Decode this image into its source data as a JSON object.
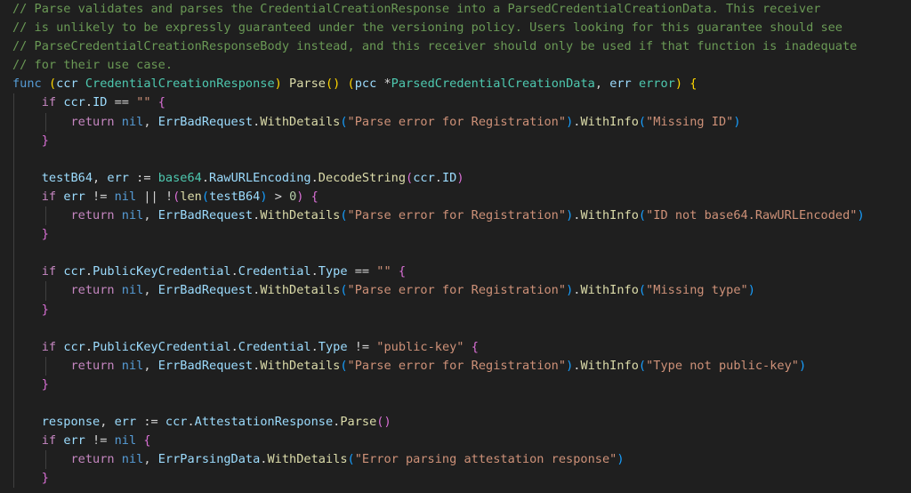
{
  "editor": {
    "language": "go",
    "lines": [
      {
        "indent": 0,
        "tokens": [
          [
            "// Parse validates and parses the CredentialCreationResponse into a ParsedCredentialCreationData. This receiver",
            "comment"
          ]
        ]
      },
      {
        "indent": 0,
        "tokens": [
          [
            "// is unlikely to be expressly guaranteed under the versioning policy. Users looking for this guarantee should see",
            "comment"
          ]
        ]
      },
      {
        "indent": 0,
        "tokens": [
          [
            "// ParseCredentialCreationResponseBody instead, and this receiver should only be used if that function is inadequate",
            "comment"
          ]
        ]
      },
      {
        "indent": 0,
        "tokens": [
          [
            "// for their use case.",
            "comment"
          ]
        ]
      },
      {
        "indent": 0,
        "tokens": [
          [
            "func",
            "kw"
          ],
          [
            " ",
            "plain"
          ],
          [
            "(",
            "b1"
          ],
          [
            "ccr",
            "var"
          ],
          [
            " ",
            "plain"
          ],
          [
            "CredentialCreationResponse",
            "type"
          ],
          [
            ")",
            "b1"
          ],
          [
            " ",
            "plain"
          ],
          [
            "Parse",
            "func"
          ],
          [
            "()",
            "b1"
          ],
          [
            " ",
            "plain"
          ],
          [
            "(",
            "b1"
          ],
          [
            "pcc",
            "var"
          ],
          [
            " ",
            "plain"
          ],
          [
            "*",
            "op"
          ],
          [
            "ParsedCredentialCreationData",
            "type"
          ],
          [
            ", ",
            "plain"
          ],
          [
            "err",
            "var"
          ],
          [
            " ",
            "plain"
          ],
          [
            "error",
            "type"
          ],
          [
            ")",
            "b1"
          ],
          [
            " ",
            "plain"
          ],
          [
            "{",
            "b1"
          ]
        ]
      },
      {
        "indent": 1,
        "tokens": [
          [
            "if",
            "ctrl"
          ],
          [
            " ",
            "plain"
          ],
          [
            "ccr",
            "var"
          ],
          [
            ".",
            "plain"
          ],
          [
            "ID",
            "var"
          ],
          [
            " == ",
            "op"
          ],
          [
            "\"\"",
            "str"
          ],
          [
            " ",
            "plain"
          ],
          [
            "{",
            "b2"
          ]
        ]
      },
      {
        "indent": 2,
        "tokens": [
          [
            "return",
            "ctrl"
          ],
          [
            " ",
            "plain"
          ],
          [
            "nil",
            "kw"
          ],
          [
            ", ",
            "plain"
          ],
          [
            "ErrBadRequest",
            "var"
          ],
          [
            ".",
            "plain"
          ],
          [
            "WithDetails",
            "func"
          ],
          [
            "(",
            "b3"
          ],
          [
            "\"Parse error for Registration\"",
            "str"
          ],
          [
            ")",
            "b3"
          ],
          [
            ".",
            "plain"
          ],
          [
            "WithInfo",
            "func"
          ],
          [
            "(",
            "b3"
          ],
          [
            "\"Missing ID\"",
            "str"
          ],
          [
            ")",
            "b3"
          ]
        ]
      },
      {
        "indent": 1,
        "tokens": [
          [
            "}",
            "b2"
          ]
        ]
      },
      {
        "indent": 1,
        "tokens": []
      },
      {
        "indent": 1,
        "tokens": [
          [
            "testB64",
            "var"
          ],
          [
            ", ",
            "plain"
          ],
          [
            "err",
            "var"
          ],
          [
            " := ",
            "op"
          ],
          [
            "base64",
            "type"
          ],
          [
            ".",
            "plain"
          ],
          [
            "RawURLEncoding",
            "var"
          ],
          [
            ".",
            "plain"
          ],
          [
            "DecodeString",
            "func"
          ],
          [
            "(",
            "b2"
          ],
          [
            "ccr",
            "var"
          ],
          [
            ".",
            "plain"
          ],
          [
            "ID",
            "var"
          ],
          [
            ")",
            "b2"
          ]
        ]
      },
      {
        "indent": 1,
        "tokens": [
          [
            "if",
            "ctrl"
          ],
          [
            " ",
            "plain"
          ],
          [
            "err",
            "var"
          ],
          [
            " != ",
            "op"
          ],
          [
            "nil",
            "kw"
          ],
          [
            " || ",
            "op"
          ],
          [
            "!",
            "op"
          ],
          [
            "(",
            "b2"
          ],
          [
            "len",
            "func"
          ],
          [
            "(",
            "b3"
          ],
          [
            "testB64",
            "var"
          ],
          [
            ")",
            "b3"
          ],
          [
            " > ",
            "op"
          ],
          [
            "0",
            "num"
          ],
          [
            ")",
            "b2"
          ],
          [
            " ",
            "plain"
          ],
          [
            "{",
            "b2"
          ]
        ]
      },
      {
        "indent": 2,
        "tokens": [
          [
            "return",
            "ctrl"
          ],
          [
            " ",
            "plain"
          ],
          [
            "nil",
            "kw"
          ],
          [
            ", ",
            "plain"
          ],
          [
            "ErrBadRequest",
            "var"
          ],
          [
            ".",
            "plain"
          ],
          [
            "WithDetails",
            "func"
          ],
          [
            "(",
            "b3"
          ],
          [
            "\"Parse error for Registration\"",
            "str"
          ],
          [
            ")",
            "b3"
          ],
          [
            ".",
            "plain"
          ],
          [
            "WithInfo",
            "func"
          ],
          [
            "(",
            "b3"
          ],
          [
            "\"ID not base64.RawURLEncoded\"",
            "str"
          ],
          [
            ")",
            "b3"
          ]
        ]
      },
      {
        "indent": 1,
        "tokens": [
          [
            "}",
            "b2"
          ]
        ]
      },
      {
        "indent": 1,
        "tokens": []
      },
      {
        "indent": 1,
        "tokens": [
          [
            "if",
            "ctrl"
          ],
          [
            " ",
            "plain"
          ],
          [
            "ccr",
            "var"
          ],
          [
            ".",
            "plain"
          ],
          [
            "PublicKeyCredential",
            "var"
          ],
          [
            ".",
            "plain"
          ],
          [
            "Credential",
            "var"
          ],
          [
            ".",
            "plain"
          ],
          [
            "Type",
            "var"
          ],
          [
            " == ",
            "op"
          ],
          [
            "\"\"",
            "str"
          ],
          [
            " ",
            "plain"
          ],
          [
            "{",
            "b2"
          ]
        ]
      },
      {
        "indent": 2,
        "tokens": [
          [
            "return",
            "ctrl"
          ],
          [
            " ",
            "plain"
          ],
          [
            "nil",
            "kw"
          ],
          [
            ", ",
            "plain"
          ],
          [
            "ErrBadRequest",
            "var"
          ],
          [
            ".",
            "plain"
          ],
          [
            "WithDetails",
            "func"
          ],
          [
            "(",
            "b3"
          ],
          [
            "\"Parse error for Registration\"",
            "str"
          ],
          [
            ")",
            "b3"
          ],
          [
            ".",
            "plain"
          ],
          [
            "WithInfo",
            "func"
          ],
          [
            "(",
            "b3"
          ],
          [
            "\"Missing type\"",
            "str"
          ],
          [
            ")",
            "b3"
          ]
        ]
      },
      {
        "indent": 1,
        "tokens": [
          [
            "}",
            "b2"
          ]
        ]
      },
      {
        "indent": 1,
        "tokens": []
      },
      {
        "indent": 1,
        "tokens": [
          [
            "if",
            "ctrl"
          ],
          [
            " ",
            "plain"
          ],
          [
            "ccr",
            "var"
          ],
          [
            ".",
            "plain"
          ],
          [
            "PublicKeyCredential",
            "var"
          ],
          [
            ".",
            "plain"
          ],
          [
            "Credential",
            "var"
          ],
          [
            ".",
            "plain"
          ],
          [
            "Type",
            "var"
          ],
          [
            " != ",
            "op"
          ],
          [
            "\"public-key\"",
            "str"
          ],
          [
            " ",
            "plain"
          ],
          [
            "{",
            "b2"
          ]
        ]
      },
      {
        "indent": 2,
        "tokens": [
          [
            "return",
            "ctrl"
          ],
          [
            " ",
            "plain"
          ],
          [
            "nil",
            "kw"
          ],
          [
            ", ",
            "plain"
          ],
          [
            "ErrBadRequest",
            "var"
          ],
          [
            ".",
            "plain"
          ],
          [
            "WithDetails",
            "func"
          ],
          [
            "(",
            "b3"
          ],
          [
            "\"Parse error for Registration\"",
            "str"
          ],
          [
            ")",
            "b3"
          ],
          [
            ".",
            "plain"
          ],
          [
            "WithInfo",
            "func"
          ],
          [
            "(",
            "b3"
          ],
          [
            "\"Type not public-key\"",
            "str"
          ],
          [
            ")",
            "b3"
          ]
        ]
      },
      {
        "indent": 1,
        "tokens": [
          [
            "}",
            "b2"
          ]
        ]
      },
      {
        "indent": 1,
        "tokens": []
      },
      {
        "indent": 1,
        "tokens": [
          [
            "response",
            "var"
          ],
          [
            ", ",
            "plain"
          ],
          [
            "err",
            "var"
          ],
          [
            " := ",
            "op"
          ],
          [
            "ccr",
            "var"
          ],
          [
            ".",
            "plain"
          ],
          [
            "AttestationResponse",
            "var"
          ],
          [
            ".",
            "plain"
          ],
          [
            "Parse",
            "func"
          ],
          [
            "()",
            "b2"
          ]
        ]
      },
      {
        "indent": 1,
        "tokens": [
          [
            "if",
            "ctrl"
          ],
          [
            " ",
            "plain"
          ],
          [
            "err",
            "var"
          ],
          [
            " != ",
            "op"
          ],
          [
            "nil",
            "kw"
          ],
          [
            " ",
            "plain"
          ],
          [
            "{",
            "b2"
          ]
        ]
      },
      {
        "indent": 2,
        "tokens": [
          [
            "return",
            "ctrl"
          ],
          [
            " ",
            "plain"
          ],
          [
            "nil",
            "kw"
          ],
          [
            ", ",
            "plain"
          ],
          [
            "ErrParsingData",
            "var"
          ],
          [
            ".",
            "plain"
          ],
          [
            "WithDetails",
            "func"
          ],
          [
            "(",
            "b3"
          ],
          [
            "\"Error parsing attestation response\"",
            "str"
          ],
          [
            ")",
            "b3"
          ]
        ]
      },
      {
        "indent": 1,
        "tokens": [
          [
            "}",
            "b2"
          ]
        ]
      }
    ]
  }
}
